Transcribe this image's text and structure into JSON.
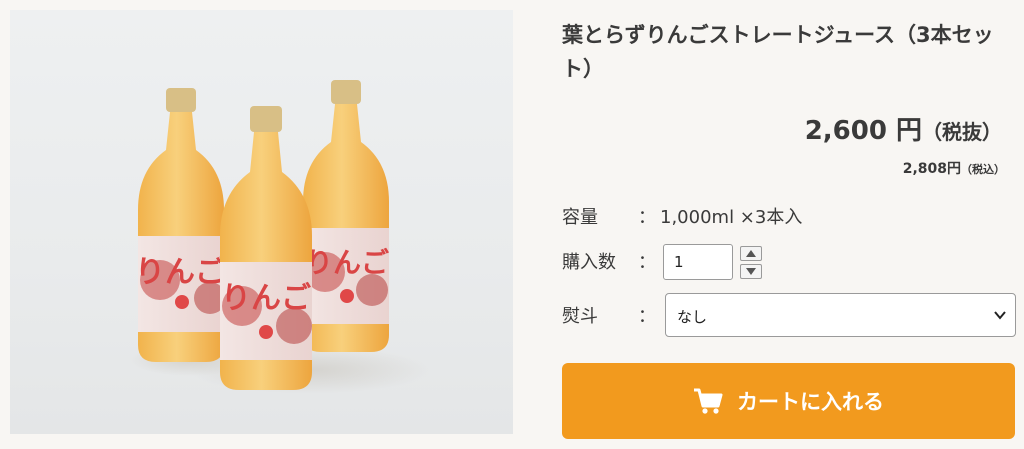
{
  "product": {
    "title": "葉とらずりんごストレートジュース（3本セット）",
    "image_alt": "りんごジュース 3本",
    "bottle_label_text": "りんご"
  },
  "price": {
    "main": "2,600 円",
    "main_suffix": "（税抜）",
    "tax_incl": "2,808円",
    "tax_incl_suffix": "（税込）"
  },
  "specs": {
    "capacity_label": "容量",
    "colon": "：",
    "capacity_value": "1,000ml ×3本入"
  },
  "quantity": {
    "label": "購入数",
    "colon": "：",
    "value": "1"
  },
  "noshi": {
    "label": "熨斗",
    "colon": "：",
    "selected": "なし"
  },
  "cart": {
    "button_label": "カートに入れる",
    "icon": "cart-icon"
  },
  "colors": {
    "accent": "#f29a1e",
    "background": "#f8f6f3",
    "text": "#3a3a3a"
  }
}
